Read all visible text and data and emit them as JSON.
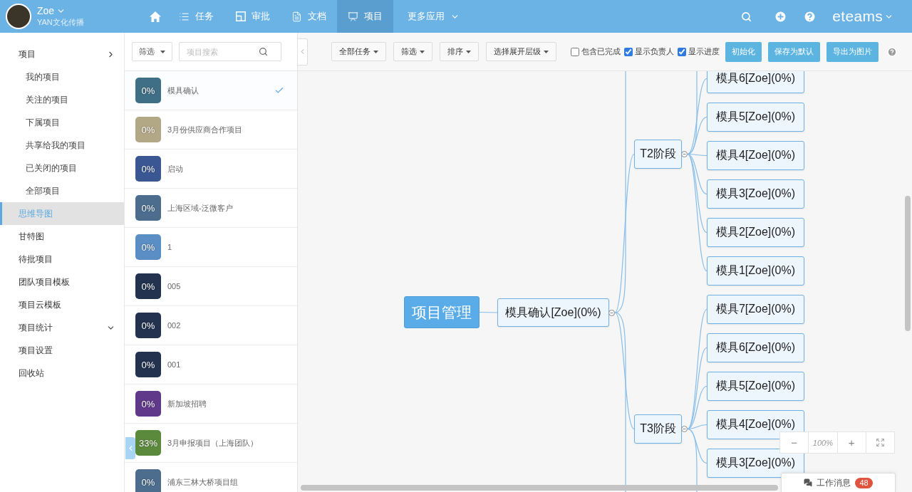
{
  "user": {
    "name": "Zoe",
    "org": "YAN文化传播"
  },
  "nav": [
    {
      "kind": "home",
      "selected": false
    },
    {
      "kind": "tab",
      "label": "任务",
      "selected": false
    },
    {
      "kind": "tab",
      "label": "审批",
      "selected": false
    },
    {
      "kind": "tab",
      "label": "文档",
      "selected": false
    },
    {
      "kind": "tab",
      "label": "项目",
      "selected": true
    },
    {
      "kind": "menu",
      "label": "更多应用",
      "selected": false
    }
  ],
  "brand": "eteams",
  "sidebar": {
    "items": [
      {
        "kind": "group",
        "label": "项目",
        "selected": false,
        "expanded": true,
        "children": [
          {
            "label": "我的项目",
            "selected": false
          },
          {
            "label": "关注的项目",
            "selected": false
          },
          {
            "label": "下属项目",
            "selected": false
          },
          {
            "label": "共享给我的项目",
            "selected": false
          },
          {
            "label": "已关闭的项目",
            "selected": false
          },
          {
            "label": "全部项目",
            "selected": false
          }
        ]
      },
      {
        "kind": "link",
        "label": "思维导图",
        "selected": true
      },
      {
        "kind": "link",
        "label": "甘特图",
        "selected": false
      },
      {
        "kind": "link",
        "label": "待批项目",
        "selected": false
      },
      {
        "kind": "link",
        "label": "团队项目模板",
        "selected": false
      },
      {
        "kind": "link",
        "label": "项目云模板",
        "selected": false
      },
      {
        "kind": "group",
        "label": "项目统计",
        "selected": false,
        "expanded": false
      },
      {
        "kind": "link",
        "label": "项目设置",
        "selected": false
      },
      {
        "kind": "link",
        "label": "回收站",
        "selected": false
      }
    ]
  },
  "project_list": {
    "filter": "筛选",
    "search": {
      "placeholder": "项目搜索"
    },
    "projects": [
      {
        "name": "模具确认",
        "progress": "0%",
        "color": "#3e6f86",
        "selected": true
      },
      {
        "name": "3月份供应商合作项目",
        "progress": "0%",
        "color": "#b2a886",
        "selected": false
      },
      {
        "name": "启动",
        "progress": "0%",
        "color": "#3b5793",
        "selected": false
      },
      {
        "name": "上海区域-泛微客户",
        "progress": "0%",
        "color": "#4c6d8e",
        "selected": false
      },
      {
        "name": "1",
        "progress": "0%",
        "color": "#5b8ec4",
        "selected": false
      },
      {
        "name": "005",
        "progress": "0%",
        "color": "#22324f",
        "selected": false
      },
      {
        "name": "002",
        "progress": "0%",
        "color": "#22324f",
        "selected": false
      },
      {
        "name": "001",
        "progress": "0%",
        "color": "#22324f",
        "selected": false
      },
      {
        "name": "新加坡招聘",
        "progress": "0%",
        "color": "#61398a",
        "selected": false
      },
      {
        "name": "3月申报项目（上海团队）",
        "progress": "33%",
        "color": "#5b8a3d",
        "selected": false
      },
      {
        "name": "浦东三林大桥项目组",
        "progress": "0%",
        "color": "#4c6d8e",
        "selected": false
      }
    ]
  },
  "toolbar": {
    "dropdowns": [
      "全部任务",
      "筛选",
      "排序",
      "选择展开层级"
    ],
    "checkboxes": [
      {
        "label": "包含已完成",
        "checked": false
      },
      {
        "label": "显示负责人",
        "checked": true
      },
      {
        "label": "显示进度",
        "checked": true
      }
    ],
    "buttons": [
      "初始化",
      "保存为默认",
      "导出为图片"
    ]
  },
  "mindmap": {
    "label": "项目管理",
    "children": [
      {
        "label": "模具确认[Zoe](0%)",
        "children": [
          {
            "label": "T2阶段",
            "children": [
              {
                "label": "模具6[Zoe](0%)"
              },
              {
                "label": "模具5[Zoe](0%)"
              },
              {
                "label": "模具4[Zoe](0%)"
              },
              {
                "label": "模具3[Zoe](0%)"
              },
              {
                "label": "模具2[Zoe](0%)"
              },
              {
                "label": "模具1[Zoe](0%)"
              }
            ]
          },
          {
            "label": "T3阶段",
            "children": [
              {
                "label": "模具7[Zoe](0%)"
              },
              {
                "label": "模具6[Zoe](0%)"
              },
              {
                "label": "模具5[Zoe](0%)"
              },
              {
                "label": "模具4[Zoe](0%)"
              },
              {
                "label": "模具3[Zoe](0%)"
              }
            ]
          }
        ]
      }
    ]
  },
  "zoom_controls": {
    "minus": "−",
    "zoom_text": "100%",
    "plus": "+"
  },
  "work_messages": {
    "label": "工作消息",
    "count": "48"
  }
}
